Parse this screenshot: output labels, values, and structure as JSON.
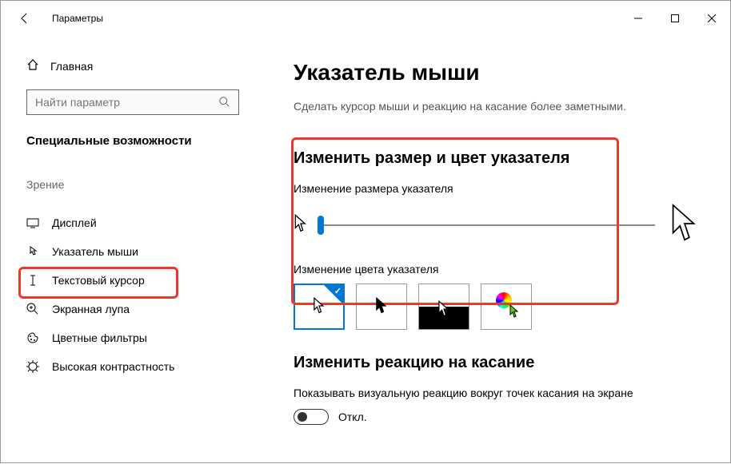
{
  "window": {
    "title": "Параметры"
  },
  "sidebar": {
    "home": "Главная",
    "search_placeholder": "Найти параметр",
    "heading": "Специальные возможности",
    "group_label": "Зрение",
    "items": [
      {
        "icon": "display",
        "label": "Дисплей"
      },
      {
        "icon": "pointer",
        "label": "Указатель мыши",
        "selected": true
      },
      {
        "icon": "text-cursor",
        "label": "Текстовый курсор"
      },
      {
        "icon": "magnifier",
        "label": "Экранная лупа"
      },
      {
        "icon": "palette",
        "label": "Цветные фильтры"
      },
      {
        "icon": "contrast",
        "label": "Высокая контрастность"
      }
    ]
  },
  "content": {
    "title": "Указатель мыши",
    "subtitle": "Сделать курсор мыши и реакцию на касание более заметными.",
    "section1_heading": "Изменить размер и цвет указателя",
    "size_label": "Изменение размера указателя",
    "color_label": "Изменение цвета указателя",
    "color_options": [
      "white",
      "black",
      "inverted",
      "custom"
    ],
    "selected_color_index": 0,
    "section2_heading": "Изменить реакцию на касание",
    "touch_desc": "Показывать визуальную реакцию вокруг точек касания на экране",
    "toggle_state": "Откл."
  }
}
